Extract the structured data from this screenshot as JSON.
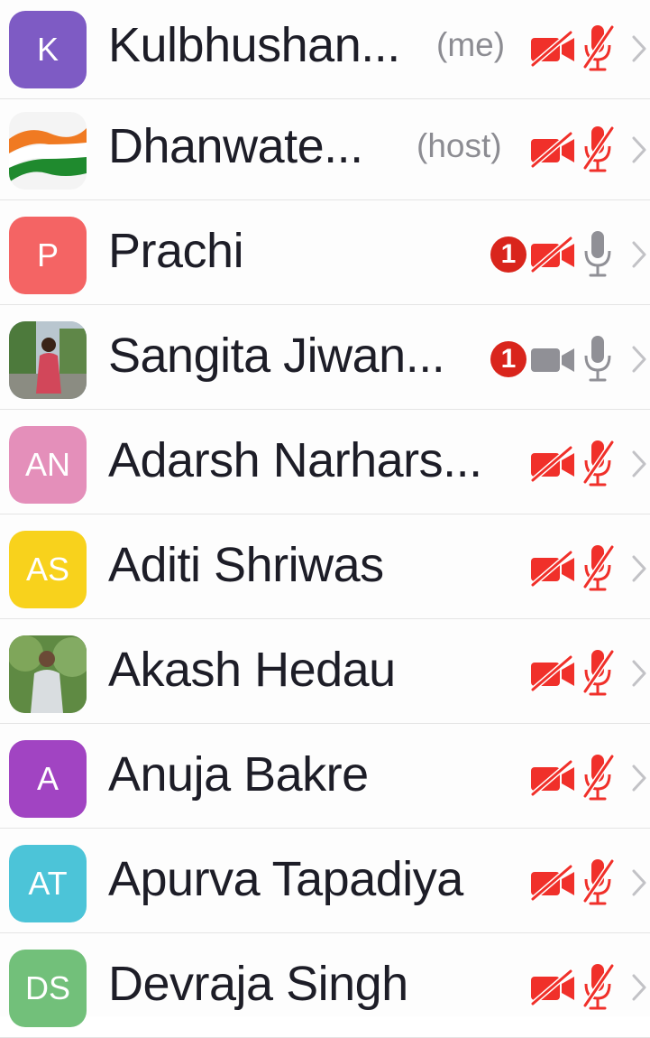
{
  "colors": {
    "muted_red": "#f0302a",
    "badge_red": "#d9251c",
    "active_gray": "#909096",
    "chevron_gray": "#c2c2c6"
  },
  "participants": [
    {
      "name": "Kulbhushan...",
      "tag": "(me)",
      "avatar_text": "K",
      "avatar_color": "#7e5bc4",
      "avatar_kind": "initials",
      "badge": "",
      "video": "muted",
      "audio": "muted"
    },
    {
      "name": "Dhanwate...",
      "tag": "(host)",
      "avatar_text": "",
      "avatar_color": "#ffffff",
      "avatar_kind": "flag-image",
      "badge": "",
      "video": "muted",
      "audio": "muted"
    },
    {
      "name": "Prachi",
      "tag": "",
      "avatar_text": "P",
      "avatar_color": "#f46464",
      "avatar_kind": "initials",
      "badge": "1",
      "video": "muted",
      "audio": "on"
    },
    {
      "name": "Sangita Jiwan...",
      "tag": "",
      "avatar_text": "",
      "avatar_color": "#8aa0b0",
      "avatar_kind": "photo",
      "badge": "1",
      "video": "on",
      "audio": "on"
    },
    {
      "name": "Adarsh Narhars...",
      "tag": "",
      "avatar_text": "AN",
      "avatar_color": "#e48fba",
      "avatar_kind": "initials",
      "badge": "",
      "video": "muted",
      "audio": "muted"
    },
    {
      "name": "Aditi Shriwas",
      "tag": "",
      "avatar_text": "AS",
      "avatar_color": "#f8d21c",
      "avatar_kind": "initials",
      "badge": "",
      "video": "muted",
      "audio": "muted"
    },
    {
      "name": "Akash Hedau",
      "tag": "",
      "avatar_text": "",
      "avatar_color": "#6f8f52",
      "avatar_kind": "photo",
      "badge": "",
      "video": "muted",
      "audio": "muted"
    },
    {
      "name": "Anuja Bakre",
      "tag": "",
      "avatar_text": "A",
      "avatar_color": "#a144c2",
      "avatar_kind": "initials",
      "badge": "",
      "video": "muted",
      "audio": "muted"
    },
    {
      "name": "Apurva Tapadiya",
      "tag": "",
      "avatar_text": "AT",
      "avatar_color": "#4cc4d8",
      "avatar_kind": "initials",
      "badge": "",
      "video": "muted",
      "audio": "muted"
    },
    {
      "name": "Devraja Singh",
      "tag": "",
      "avatar_text": "DS",
      "avatar_color": "#72c07a",
      "avatar_kind": "initials",
      "badge": "",
      "video": "muted",
      "audio": "muted"
    }
  ]
}
